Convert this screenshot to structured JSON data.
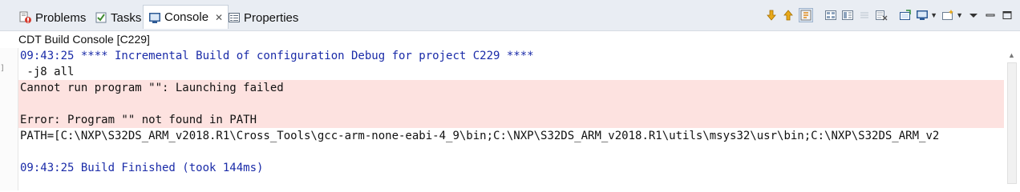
{
  "tabs": [
    {
      "label": "Problems",
      "icon": "problems-icon",
      "active": false
    },
    {
      "label": "Tasks",
      "icon": "tasks-icon",
      "active": false
    },
    {
      "label": "Console",
      "icon": "console-icon",
      "active": true,
      "close": "✕"
    },
    {
      "label": "Properties",
      "icon": "properties-icon",
      "active": false
    }
  ],
  "toolbar": {
    "icons": [
      "scroll-down-icon",
      "scroll-up-icon",
      "scroll-lock-icon",
      "word-wrap-icon",
      "pin-console-icon",
      "clear-console-icon",
      "open-console-icon",
      "display-selected-console-icon",
      "new-console-icon",
      "view-menu-icon",
      "minimize-icon",
      "maximize-icon"
    ]
  },
  "console": {
    "title": "CDT Build Console [C229]",
    "lines": [
      {
        "text": "09:43:25 **** Incremental Build of configuration Debug for project C229 ****",
        "kind": "info"
      },
      {
        "text": " -j8 all",
        "kind": "plain"
      },
      {
        "text": "Cannot run program \"\": Launching failed",
        "kind": "error"
      },
      {
        "text": "",
        "kind": "plain"
      },
      {
        "text": "Error: Program \"\" not found in PATH",
        "kind": "error"
      },
      {
        "text": "PATH=[C:\\NXP\\S32DS_ARM_v2018.R1\\Cross_Tools\\gcc-arm-none-eabi-4_9\\bin;C:\\NXP\\S32DS_ARM_v2018.R1\\utils\\msys32\\usr\\bin;C:\\NXP\\S32DS_ARM_v2",
        "kind": "plain"
      },
      {
        "text": "",
        "kind": "plain"
      },
      {
        "text": "09:43:25 Build Finished (took 144ms)",
        "kind": "info"
      }
    ]
  },
  "colors": {
    "info_text": "#1a2ba8",
    "error_bg": "#fde2e0",
    "tabbar_bg": "#e9edf3"
  }
}
